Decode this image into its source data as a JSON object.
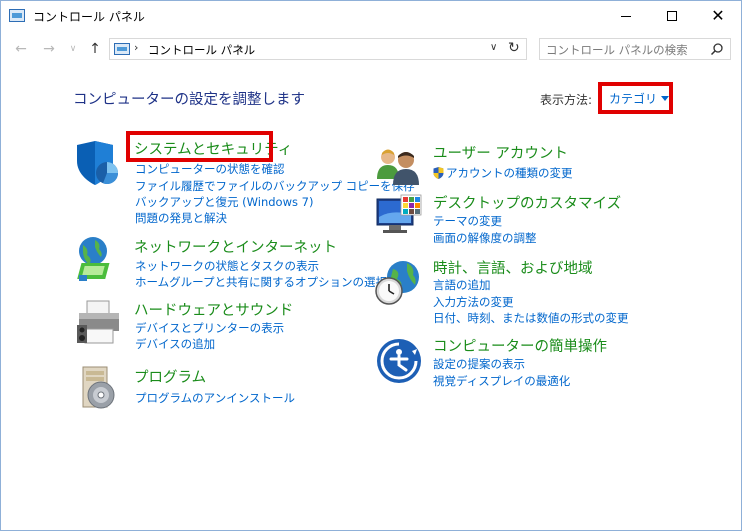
{
  "window": {
    "title": "コントロール パネル",
    "minimize_icon": "minimize-icon",
    "maximize_icon": "maximize-icon",
    "close_glyph": "✕"
  },
  "nav": {
    "back_glyph": "←",
    "forward_glyph": "→",
    "recent_glyph": "∨",
    "up_glyph": "↑",
    "breadcrumb": "コントロール パネル",
    "separator": "›",
    "dropdown_glyph": "∨",
    "refresh_glyph": "↻",
    "search_placeholder": "コントロール パネルの検索"
  },
  "main": {
    "heading": "コンピューターの設定を調整します",
    "view_label": "表示方法:",
    "view_value": "カテゴリ"
  },
  "categories": [
    {
      "icon": "shield-icon",
      "title": "システムとセキュリティ",
      "links": [
        "コンピューターの状態を確認",
        "ファイル履歴でファイルのバックアップ コピーを保存",
        "バックアップと復元 (Windows 7)",
        "問題の発見と解決"
      ]
    },
    {
      "icon": "network-globe-icon",
      "title": "ネットワークとインターネット",
      "links": [
        "ネットワークの状態とタスクの表示",
        "ホームグループと共有に関するオプションの選択"
      ]
    },
    {
      "icon": "printer-icon",
      "title": "ハードウェアとサウンド",
      "links": [
        "デバイスとプリンターの表示",
        "デバイスの追加"
      ]
    },
    {
      "icon": "programs-icon",
      "title": "プログラム",
      "links": [
        "プログラムのアンインストール"
      ]
    },
    {
      "icon": "users-icon",
      "title": "ユーザー アカウント",
      "links": [
        "アカウントの種類の変更"
      ]
    },
    {
      "icon": "display-icon",
      "title": "デスクトップのカスタマイズ",
      "links": [
        "テーマの変更",
        "画面の解像度の調整"
      ]
    },
    {
      "icon": "clock-globe-icon",
      "title": "時計、言語、および地域",
      "links": [
        "言語の追加",
        "入力方法の変更",
        "日付、時刻、または数値の形式の変更"
      ]
    },
    {
      "icon": "ease-of-access-icon",
      "title": "コンピューターの簡単操作",
      "links": [
        "設定の提案の表示",
        "視覚ディスプレイの最適化"
      ]
    }
  ],
  "colors": {
    "heading": "#1e3287",
    "category_title": "#1a8c1a",
    "link": "#0066cc",
    "highlight": "#e00000"
  }
}
